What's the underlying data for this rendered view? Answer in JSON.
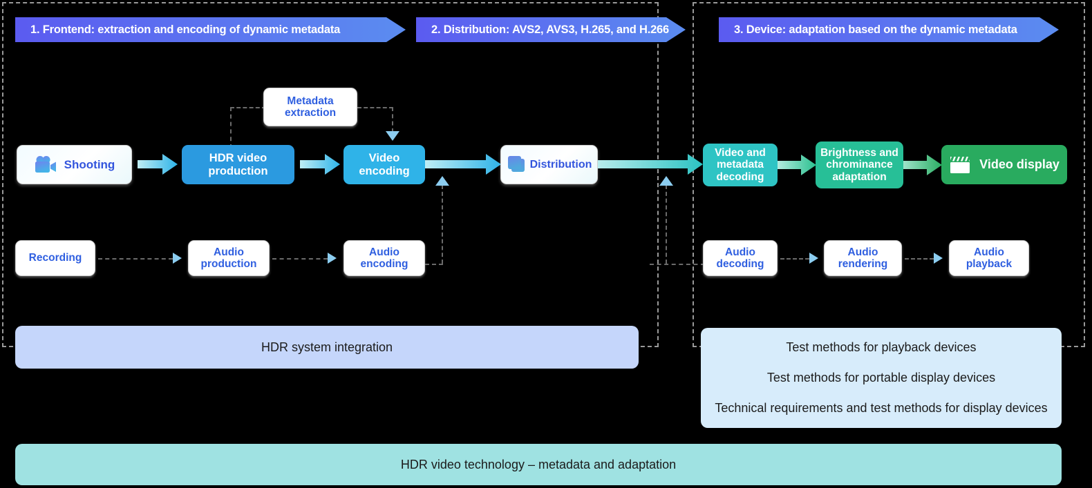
{
  "diagram": {
    "title": "HDR video technology end-to-end workflow",
    "colors": {
      "banner_start": "#5b5bf0",
      "banner_end": "#5b8cf0",
      "blue_dark": "#2b9ae0",
      "blue_light": "#2fb3e8",
      "cyan": "#2ec4c4",
      "teal": "#27bf97",
      "green": "#29ab5f",
      "panel_blue": "#c5d6fb",
      "panel_lightblue": "#d7ecfb",
      "panel_teal": "#9fe2e2",
      "dashed_gray": "#9a9a9a",
      "node_text_blue": "#2f5fe0",
      "background": "#000000"
    }
  },
  "banners": [
    {
      "id": "frontend",
      "label": "1. Frontend: extraction and encoding of dynamic metadata"
    },
    {
      "id": "distribution",
      "label": "2. Distribution: AVS2, AVS3, H.265, and H.266"
    },
    {
      "id": "device",
      "label": "3. Device: adaptation based on the dynamic metadata"
    }
  ],
  "video_chain": {
    "shooting": {
      "label": "Shooting",
      "icon": "video-camera-icon"
    },
    "hdr_video_production": {
      "label": "HDR video production"
    },
    "metadata_extraction": {
      "label": "Metadata extraction"
    },
    "video_encoding": {
      "label": "Video encoding"
    },
    "distribution": {
      "label": "Distribution",
      "icon": "layered-screens-icon"
    }
  },
  "audio_chain": {
    "recording": {
      "label": "Recording"
    },
    "audio_production": {
      "label": "Audio production"
    },
    "audio_encoding": {
      "label": "Audio encoding"
    }
  },
  "device_video_chain": {
    "video_metadata_decoding": {
      "label": "Video and metadata decoding"
    },
    "brightness_chrominance_adaptation": {
      "label": "Brightness and chrominance adaptation"
    },
    "video_display": {
      "label": "Video display",
      "icon": "clapperboard-icon"
    }
  },
  "device_audio_chain": {
    "audio_decoding": {
      "label": "Audio decoding"
    },
    "audio_rendering": {
      "label": "Audio rendering"
    },
    "audio_playback": {
      "label": "Audio playback"
    }
  },
  "panels": {
    "hdr_system_integration": {
      "label": "HDR system integration"
    },
    "device_tests": {
      "lines": [
        "Test methods for playback devices",
        "Test methods for portable display devices",
        "Technical requirements and test methods for display devices"
      ]
    },
    "footer": {
      "label": "HDR video technology – metadata and adaptation"
    }
  }
}
